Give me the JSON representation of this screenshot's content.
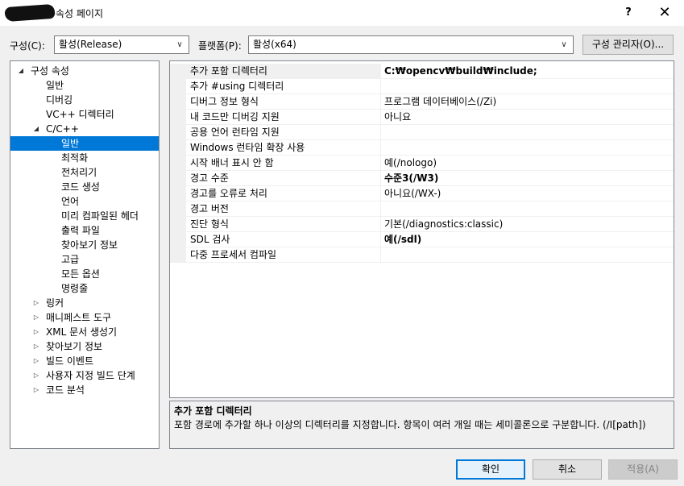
{
  "window": {
    "title": "속성 페이지",
    "help_glyph": "?",
    "close_glyph": "✕"
  },
  "toolbar": {
    "config_label": "구성(C):",
    "config_value": "활성(Release)",
    "platform_label": "플랫폼(P):",
    "platform_value": "활성(x64)",
    "config_manager_label": "구성 관리자(O)..."
  },
  "tree": {
    "items": [
      {
        "label": "구성 속성",
        "twisty": "◢"
      },
      {
        "label": "일반"
      },
      {
        "label": "디버깅"
      },
      {
        "label": "VC++ 디렉터리"
      },
      {
        "label": "C/C++",
        "twisty": "◢"
      },
      {
        "label": "일반"
      },
      {
        "label": "최적화"
      },
      {
        "label": "전처리기"
      },
      {
        "label": "코드 생성"
      },
      {
        "label": "언어"
      },
      {
        "label": "미리 컴파일된 헤더"
      },
      {
        "label": "출력 파일"
      },
      {
        "label": "찾아보기 정보"
      },
      {
        "label": "고급"
      },
      {
        "label": "모든 옵션"
      },
      {
        "label": "명령줄"
      },
      {
        "label": "링커",
        "twisty": "▷"
      },
      {
        "label": "매니페스트 도구",
        "twisty": "▷"
      },
      {
        "label": "XML 문서 생성기",
        "twisty": "▷"
      },
      {
        "label": "찾아보기 정보",
        "twisty": "▷"
      },
      {
        "label": "빌드 이벤트",
        "twisty": "▷"
      },
      {
        "label": "사용자 지정 빌드 단계",
        "twisty": "▷"
      },
      {
        "label": "코드 분석",
        "twisty": "▷"
      }
    ]
  },
  "grid": {
    "rows": [
      {
        "name": "추가 포함 디렉터리",
        "value": "C:₩opencv₩build₩include;"
      },
      {
        "name": "추가 #using 디렉터리",
        "value": ""
      },
      {
        "name": "디버그 정보 형식",
        "value": "프로그램 데이터베이스(/Zi)"
      },
      {
        "name": "내 코드만 디버깅 지원",
        "value": "아니요"
      },
      {
        "name": "공용 언어 런타임 지원",
        "value": ""
      },
      {
        "name": "Windows 런타임 확장 사용",
        "value": ""
      },
      {
        "name": "시작 배너 표시 안 함",
        "value": "예(/nologo)"
      },
      {
        "name": "경고 수준",
        "value": "수준3(/W3)"
      },
      {
        "name": "경고를 오류로 처리",
        "value": "아니요(/WX-)"
      },
      {
        "name": "경고 버전",
        "value": ""
      },
      {
        "name": "진단 형식",
        "value": "기본(/diagnostics:classic)"
      },
      {
        "name": "SDL 검사",
        "value": "예(/sdl)"
      },
      {
        "name": "다중 프로세서 컴파일",
        "value": ""
      }
    ]
  },
  "description": {
    "title": "추가 포함 디렉터리",
    "text": "포함 경로에 추가할 하나 이상의 디렉터리를 지정합니다. 항목이 여러 개일 때는 세미콜론으로 구분합니다.     (/I[path])"
  },
  "footer": {
    "ok_label": "확인",
    "cancel_label": "취소",
    "apply_label": "적용(A)"
  },
  "colors": {
    "selection": "#0078d7",
    "window_bg": "#f0f0f0"
  }
}
